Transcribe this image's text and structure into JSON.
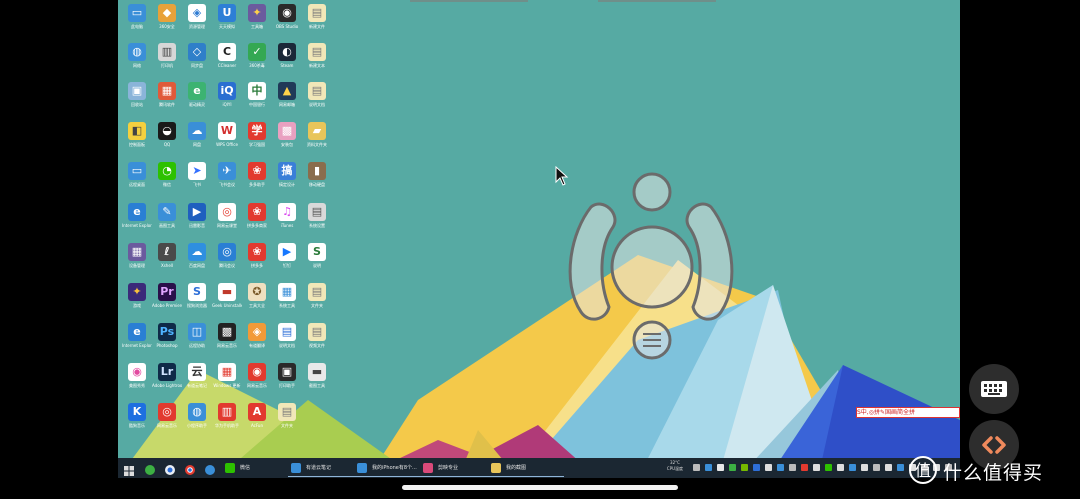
{
  "desktop": {
    "icons": [
      {
        "label": "此电脑",
        "color": "#3a8fd8",
        "glyph": "▭",
        "glyph_color": "#ffffff"
      },
      {
        "label": "360安全",
        "color": "#e8a23a",
        "glyph": "◆",
        "glyph_color": "#ffffff"
      },
      {
        "label": "资源管理",
        "color": "#ffffff",
        "glyph": "◈",
        "glyph_color": "#2e7bd3"
      },
      {
        "label": "天天模拟",
        "color": "#2d7fd6",
        "glyph": "U",
        "glyph_color": "#ffffff"
      },
      {
        "label": "工具箱",
        "color": "#6b5a9e",
        "glyph": "✦",
        "glyph_color": "#ffd24a"
      },
      {
        "label": "OBS Studio",
        "color": "#2a2a2a",
        "glyph": "◉",
        "glyph_color": "#ffffff"
      },
      {
        "label": "新建文件",
        "color": "#f1e7b8",
        "glyph": "▤",
        "glyph_color": "#7a7a7a"
      },
      {
        "label": "网络",
        "color": "#3a8fd8",
        "glyph": "◍",
        "glyph_color": "#ffffff"
      },
      {
        "label": "打印机",
        "color": "#d7d7d7",
        "glyph": "▥",
        "glyph_color": "#444444"
      },
      {
        "label": "同步盘",
        "color": "#2f7fc9",
        "glyph": "◇",
        "glyph_color": "#ffffff"
      },
      {
        "label": "CCleaner",
        "color": "#ffffff",
        "glyph": "C",
        "glyph_color": "#222222"
      },
      {
        "label": "360杀毒",
        "color": "#34a853",
        "glyph": "✓",
        "glyph_color": "#ffffff"
      },
      {
        "label": "Steam",
        "color": "#1b2838",
        "glyph": "◐",
        "glyph_color": "#ffffff"
      },
      {
        "label": "新建文本",
        "color": "#f1e7b8",
        "glyph": "▤",
        "glyph_color": "#7a7a7a"
      },
      {
        "label": "回收站",
        "color": "#8ab4d9",
        "glyph": "▣",
        "glyph_color": "#ffffff"
      },
      {
        "label": "腾讯软件",
        "color": "#e05a3a",
        "glyph": "▦",
        "glyph_color": "#ffffff"
      },
      {
        "label": "驱动精灵",
        "color": "#3cb371",
        "glyph": "e",
        "glyph_color": "#ffffff"
      },
      {
        "label": "iQIYI",
        "color": "#2a6fd1",
        "glyph": "iQ",
        "glyph_color": "#ffffff"
      },
      {
        "label": "中国银行",
        "color": "#ffffff",
        "glyph": "中",
        "glyph_color": "#2b7b3a"
      },
      {
        "label": "网易邮箱",
        "color": "#203a58",
        "glyph": "▲",
        "glyph_color": "#ffd24a"
      },
      {
        "label": "说明文档",
        "color": "#f1e7b8",
        "glyph": "▤",
        "glyph_color": "#7a7a7a"
      },
      {
        "label": "控制面板",
        "color": "#f4d03f",
        "glyph": "◧",
        "glyph_color": "#444444"
      },
      {
        "label": "QQ",
        "color": "#1a1a1a",
        "glyph": "◒",
        "glyph_color": "#ffffff"
      },
      {
        "label": "网盘",
        "color": "#3a8fd8",
        "glyph": "☁",
        "glyph_color": "#ffffff"
      },
      {
        "label": "WPS Office",
        "color": "#ffffff",
        "glyph": "W",
        "glyph_color": "#d32f2f"
      },
      {
        "label": "学习强国",
        "color": "#e23a2f",
        "glyph": "学",
        "glyph_color": "#ffffff"
      },
      {
        "label": "安装包",
        "color": "#e9a0c0",
        "glyph": "▩",
        "glyph_color": "#ffffff"
      },
      {
        "label": "资料文件夹",
        "color": "#e8c55a",
        "glyph": "▰",
        "glyph_color": "#ffffff"
      },
      {
        "label": "远程桌面",
        "color": "#3a8fd8",
        "glyph": "▭",
        "glyph_color": "#ffffff"
      },
      {
        "label": "微信",
        "color": "#2dc100",
        "glyph": "◔",
        "glyph_color": "#ffffff"
      },
      {
        "label": "飞书",
        "color": "#ffffff",
        "glyph": "➤",
        "glyph_color": "#3370ff"
      },
      {
        "label": "飞书会议",
        "color": "#3a8fd8",
        "glyph": "✈",
        "glyph_color": "#ffffff"
      },
      {
        "label": "多多助手",
        "color": "#e23a2f",
        "glyph": "❀",
        "glyph_color": "#ffffff"
      },
      {
        "label": "搞定设计",
        "color": "#3a7fd8",
        "glyph": "搞",
        "glyph_color": "#ffffff"
      },
      {
        "label": "移动硬盘",
        "color": "#8a6d4d",
        "glyph": "▮",
        "glyph_color": "#ffffff"
      },
      {
        "label": "Internet Explorer",
        "color": "#2a7fd4",
        "glyph": "e",
        "glyph_color": "#ffffff"
      },
      {
        "label": "画图工具",
        "color": "#3a8fd8",
        "glyph": "✎",
        "glyph_color": "#ffffff"
      },
      {
        "label": "迅雷影音",
        "color": "#1f5fbf",
        "glyph": "▶",
        "glyph_color": "#ffffff"
      },
      {
        "label": "网易云课堂",
        "color": "#ffffff",
        "glyph": "◎",
        "glyph_color": "#e23a2f"
      },
      {
        "label": "拼多多商家",
        "color": "#e23a2f",
        "glyph": "❀",
        "glyph_color": "#ffffff"
      },
      {
        "label": "iTunes",
        "color": "#ffffff",
        "glyph": "♫",
        "glyph_color": "#d946ef"
      },
      {
        "label": "系统设置",
        "color": "#d9d9d9",
        "glyph": "▤",
        "glyph_color": "#555555"
      },
      {
        "label": "设备管理",
        "color": "#6b5a9e",
        "glyph": "▦",
        "glyph_color": "#ffffff"
      },
      {
        "label": "Xshell",
        "color": "#4a4a4a",
        "glyph": "ℓ",
        "glyph_color": "#ffffff"
      },
      {
        "label": "百度网盘",
        "color": "#2f8fe0",
        "glyph": "☁",
        "glyph_color": "#ffffff"
      },
      {
        "label": "腾讯会议",
        "color": "#2a7fd4",
        "glyph": "◎",
        "glyph_color": "#ffffff"
      },
      {
        "label": "拼多多",
        "color": "#e23a2f",
        "glyph": "❀",
        "glyph_color": "#ffffff"
      },
      {
        "label": "钉钉",
        "color": "#ffffff",
        "glyph": "▶",
        "glyph_color": "#1677ff"
      },
      {
        "label": "说明",
        "color": "#ffffff",
        "glyph": "S",
        "glyph_color": "#2b7b3a"
      },
      {
        "label": "游戏",
        "color": "#3b2a7a",
        "glyph": "✦",
        "glyph_color": "#f9c23c"
      },
      {
        "label": "Adobe Premiere",
        "color": "#2a0f4a",
        "glyph": "Pr",
        "glyph_color": "#e0a6ff"
      },
      {
        "label": "搜狗浏览器",
        "color": "#ffffff",
        "glyph": "S",
        "glyph_color": "#2e6fd8"
      },
      {
        "label": "Geek Uninstaller",
        "color": "#ffffff",
        "glyph": "▬",
        "glyph_color": "#c0392b"
      },
      {
        "label": "工具大全",
        "color": "#f0e0c0",
        "glyph": "✪",
        "glyph_color": "#7a5a2a"
      },
      {
        "label": "系统工具",
        "color": "#ffffff",
        "glyph": "▦",
        "glyph_color": "#3a8fd8"
      },
      {
        "label": "文件夹",
        "color": "#f1e7b8",
        "glyph": "▤",
        "glyph_color": "#7a7a7a"
      },
      {
        "label": "Internet Explorer",
        "color": "#2a7fd4",
        "glyph": "e",
        "glyph_color": "#ffffff"
      },
      {
        "label": "Photoshop",
        "color": "#0f2a48",
        "glyph": "Ps",
        "glyph_color": "#4fb3ff"
      },
      {
        "label": "远程协助",
        "color": "#3a8fd8",
        "glyph": "◫",
        "glyph_color": "#ffffff"
      },
      {
        "label": "网易云音乐",
        "color": "#222222",
        "glyph": "▩",
        "glyph_color": "#ffffff"
      },
      {
        "label": "有道翻译",
        "color": "#f29a38",
        "glyph": "◈",
        "glyph_color": "#ffffff"
      },
      {
        "label": "说明文档",
        "color": "#ffffff",
        "glyph": "▤",
        "glyph_color": "#2e6fd8"
      },
      {
        "label": "视频文件",
        "color": "#f1e7b8",
        "glyph": "▤",
        "glyph_color": "#7a7a7a"
      },
      {
        "label": "美图秀秀",
        "color": "#ffffff",
        "glyph": "◉",
        "glyph_color": "#e24aa0"
      },
      {
        "label": "Adobe Lightroom",
        "color": "#0f2a48",
        "glyph": "Lr",
        "glyph_color": "#cfe3ff"
      },
      {
        "label": "有道云笔记",
        "color": "#ffffff",
        "glyph": "云",
        "glyph_color": "#333333"
      },
      {
        "label": "Windows 更新",
        "color": "#ffffff",
        "glyph": "▦",
        "glyph_color": "#e23a2f"
      },
      {
        "label": "网易云音乐",
        "color": "#e23a2f",
        "glyph": "◉",
        "glyph_color": "#ffffff"
      },
      {
        "label": "打印助手",
        "color": "#2a2a2a",
        "glyph": "▣",
        "glyph_color": "#ffffff"
      },
      {
        "label": "截图工具",
        "color": "#e9e9e9",
        "glyph": "▬",
        "glyph_color": "#444444"
      },
      {
        "label": "酷狗音乐",
        "color": "#1e6fe0",
        "glyph": "K",
        "glyph_color": "#ffffff"
      },
      {
        "label": "网易云音乐",
        "color": "#e23a2f",
        "glyph": "◎",
        "glyph_color": "#ffffff"
      },
      {
        "label": "小程序助手",
        "color": "#3a8fd8",
        "glyph": "◍",
        "glyph_color": "#ffffff"
      },
      {
        "label": "华为手机助手",
        "color": "#e23a2f",
        "glyph": "▥",
        "glyph_color": "#ffffff"
      },
      {
        "label": "AcFun",
        "color": "#e23a2f",
        "glyph": "A",
        "glyph_color": "#ffffff"
      },
      {
        "label": "文件夹",
        "color": "#f1e7b8",
        "glyph": "▤",
        "glyph_color": "#7a7a7a"
      }
    ]
  },
  "taskbar": {
    "apps": [
      {
        "label": "有道云笔记",
        "color": "#3a8fd8"
      },
      {
        "label": "我的iPhone有8个...",
        "color": "#3a8fd8"
      },
      {
        "label": "剪映专业",
        "color": "#d94a7a"
      },
      {
        "label": "我的截图",
        "color": "#e8c55a"
      }
    ],
    "wechat_label": "微信",
    "clock_temp": "32°C",
    "clock_cpu": "CPU温度"
  },
  "ime_bar": {
    "text": "S中,◎拼✎国画简全拼"
  },
  "controls": {
    "keyboard_icon": "keyboard-icon",
    "code_icon": "chevrons-icon"
  },
  "watermark": {
    "text": "什么值得买"
  }
}
